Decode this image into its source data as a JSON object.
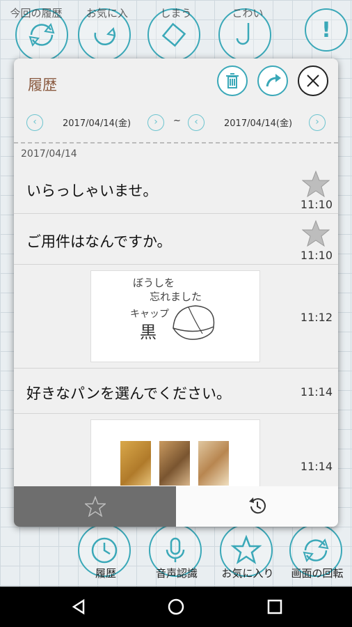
{
  "toolbar_top": {
    "labels": [
      "今回の履歴",
      "お気に入",
      "しまう",
      "こわい"
    ],
    "alert_icon": "exclamation-icon"
  },
  "dialog": {
    "title": "履歴",
    "date_from": "2017/04/14(金)",
    "date_to": "2017/04/14(金)",
    "range_sep": "~",
    "day_header": "2017/04/14",
    "entries": [
      {
        "text": "いらっしゃいませ。",
        "time": "11:10"
      },
      {
        "text": "ご用件はなんですか。",
        "time": "11:10"
      },
      {
        "text": "",
        "time": "11:12"
      },
      {
        "text": "好きなパンを選んでください。",
        "time": "11:14"
      },
      {
        "text": "",
        "time": "11:14"
      }
    ],
    "sketch_text": [
      "ぼうしを",
      "忘れました",
      "キャップ",
      "黒"
    ]
  },
  "toolbar_bottom": {
    "labels": [
      "履歴",
      "音声認識",
      "お気に入り",
      "画面の回転"
    ]
  },
  "colors": {
    "accent": "#3aa8b8",
    "title": "#8a5a40",
    "tab_active": "#6e6e6e"
  }
}
